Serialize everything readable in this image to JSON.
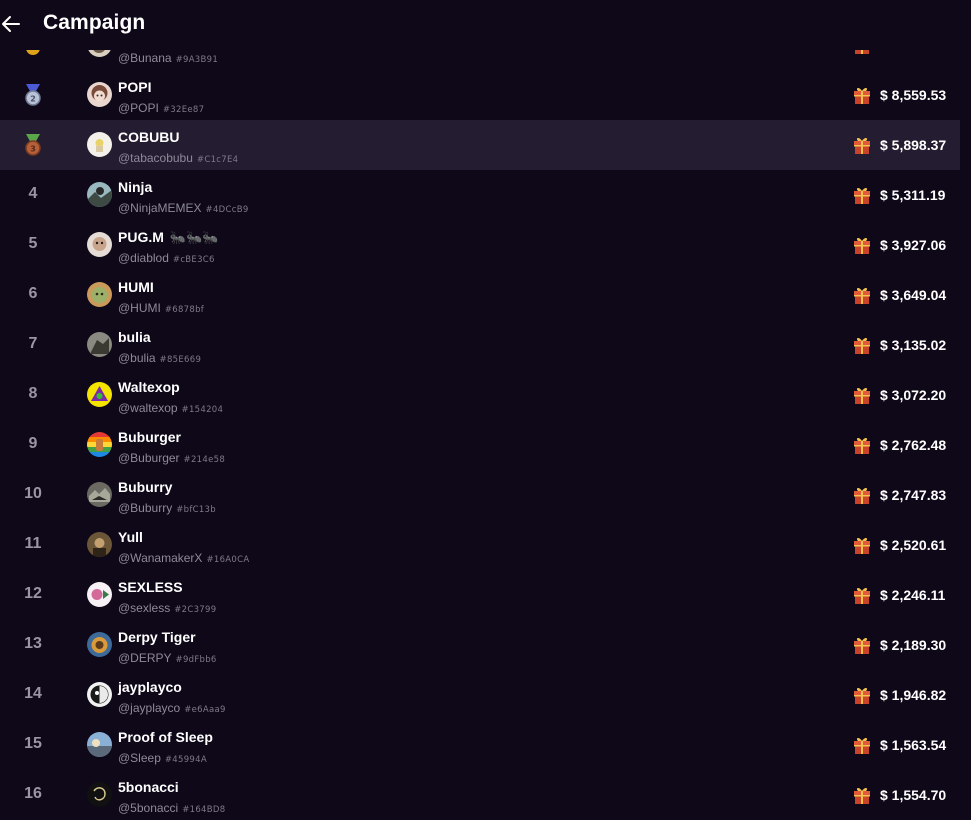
{
  "header": {
    "title": "Campaign",
    "back_icon": "arrow-left-icon"
  },
  "colors": {
    "background": "#0e0818",
    "highlight_row": "#241c30",
    "muted_text": "#8e8a9a",
    "gift": "#c0392b"
  },
  "rows": [
    {
      "rank": "",
      "medal": "gold",
      "name": "",
      "handle": "@Bunana",
      "tag": "#9A3B91",
      "amount": "",
      "partial": true
    },
    {
      "rank": "",
      "medal": "silver",
      "name": "POPI",
      "handle": "@POPI",
      "tag": "#32Ee87",
      "amount": "$ 8,559.53"
    },
    {
      "rank": "",
      "medal": "bronze",
      "name": "COBUBU",
      "handle": "@tabacobubu",
      "tag": "#C1c7E4",
      "amount": "$ 5,898.37",
      "highlight": true
    },
    {
      "rank": "4",
      "name": "Ninja",
      "handle": "@NinjaMEMEX",
      "tag": "#4DCcB9",
      "amount": "$ 5,311.19"
    },
    {
      "rank": "5",
      "name": "PUG.M",
      "name_suffix": "🐜🐜🐜",
      "handle": "@diablod",
      "tag": "#cBE3C6",
      "amount": "$ 3,927.06"
    },
    {
      "rank": "6",
      "name": "HUMI",
      "handle": "@HUMI",
      "tag": "#6878bf",
      "amount": "$ 3,649.04"
    },
    {
      "rank": "7",
      "name": "bulia",
      "handle": "@bulia",
      "tag": "#85E669",
      "amount": "$ 3,135.02"
    },
    {
      "rank": "8",
      "name": "Waltexop",
      "handle": "@waltexop",
      "tag": "#154204",
      "amount": "$ 3,072.20"
    },
    {
      "rank": "9",
      "name": "Buburger",
      "handle": "@Buburger",
      "tag": "#214e58",
      "amount": "$ 2,762.48"
    },
    {
      "rank": "10",
      "name": "Buburry",
      "handle": "@Buburry",
      "tag": "#bfC13b",
      "amount": "$ 2,747.83"
    },
    {
      "rank": "11",
      "name": "Yull",
      "handle": "@WanamakerX",
      "tag": "#16A0CA",
      "amount": "$ 2,520.61"
    },
    {
      "rank": "12",
      "name": "SEXLESS",
      "handle": "@sexless",
      "tag": "#2C3799",
      "amount": "$ 2,246.11"
    },
    {
      "rank": "13",
      "name": "Derpy Tiger",
      "handle": "@DERPY",
      "tag": "#9dFbb6",
      "amount": "$ 2,189.30"
    },
    {
      "rank": "14",
      "name": "jayplayco",
      "handle": "@jayplayco",
      "tag": "#e6Aaa9",
      "amount": "$ 1,946.82"
    },
    {
      "rank": "15",
      "name": "Proof of Sleep",
      "handle": "@Sleep",
      "tag": "#45994A",
      "amount": "$ 1,563.54"
    },
    {
      "rank": "16",
      "name": "5bonacci",
      "handle": "@5bonacci",
      "tag": "#164BD8",
      "amount": "$ 1,554.70"
    }
  ]
}
